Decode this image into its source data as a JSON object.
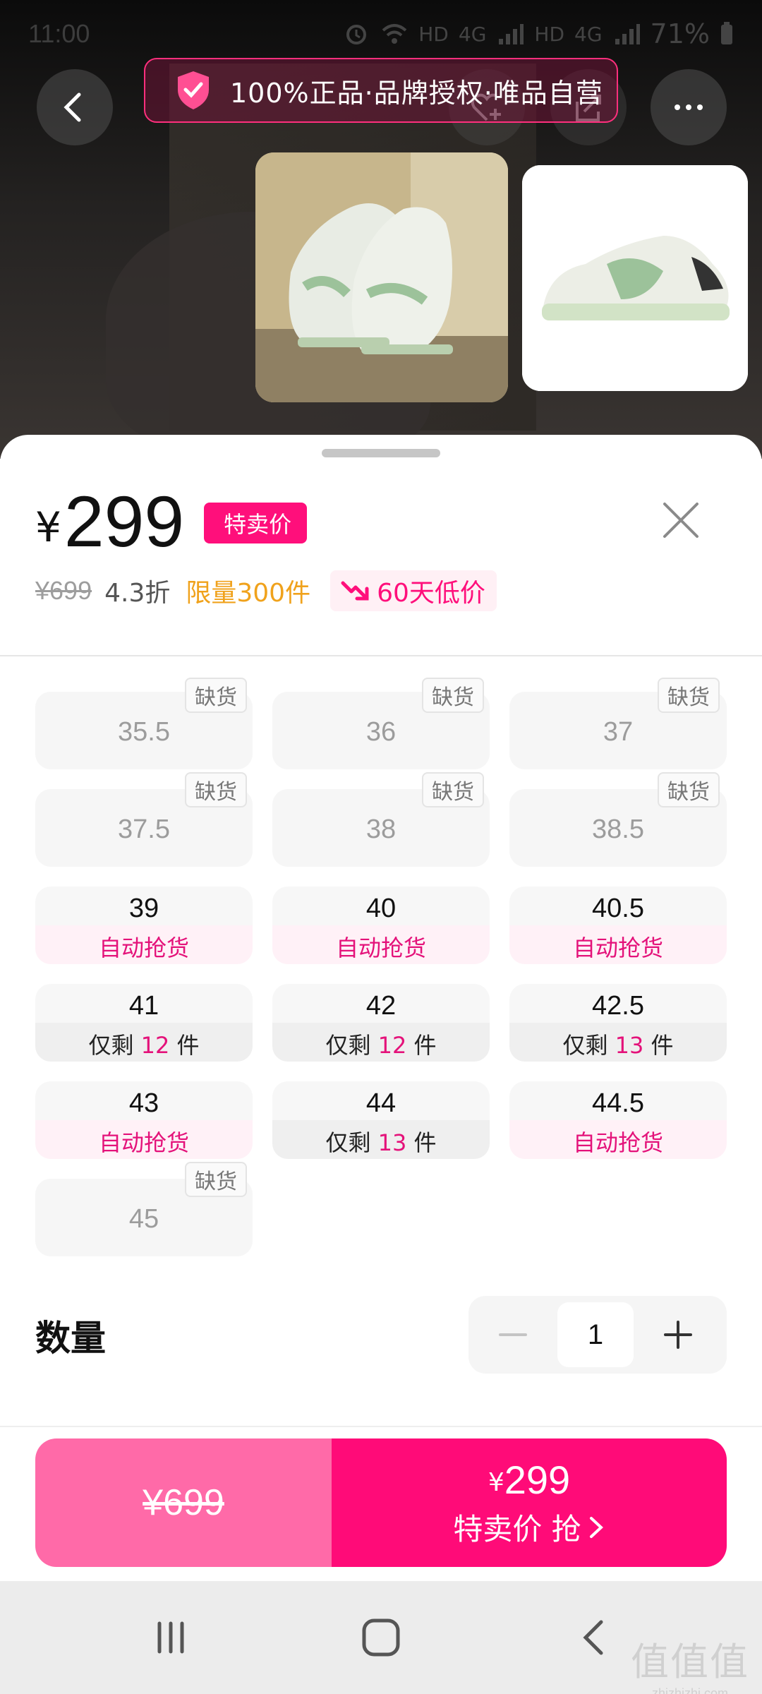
{
  "status_bar": {
    "time": "11:00",
    "network_1": "HD",
    "network_2": "4G",
    "network_3": "HD",
    "network_4": "4G",
    "battery": "71%"
  },
  "guarantee_banner": {
    "text": "100%正品·品牌授权·唯品自营"
  },
  "product": {
    "currency": "¥",
    "price": "299",
    "price_tag": "特卖价",
    "original_price": "¥699",
    "discount": "4.3折",
    "limit": "限量300件",
    "low_price_badge": "60天低价"
  },
  "sizes": [
    {
      "size": "35.5",
      "status": "oos",
      "badge": "缺货"
    },
    {
      "size": "36",
      "status": "oos",
      "badge": "缺货"
    },
    {
      "size": "37",
      "status": "oos",
      "badge": "缺货"
    },
    {
      "size": "37.5",
      "status": "oos",
      "badge": "缺货"
    },
    {
      "size": "38",
      "status": "oos",
      "badge": "缺货"
    },
    {
      "size": "38.5",
      "status": "oos",
      "badge": "缺货"
    },
    {
      "size": "39",
      "status": "auto",
      "sub": "自动抢货"
    },
    {
      "size": "40",
      "status": "auto",
      "sub": "自动抢货"
    },
    {
      "size": "40.5",
      "status": "auto",
      "sub": "自动抢货"
    },
    {
      "size": "41",
      "status": "left",
      "prefix": "仅剩 ",
      "count": "12",
      "suffix": " 件"
    },
    {
      "size": "42",
      "status": "left",
      "prefix": "仅剩 ",
      "count": "12",
      "suffix": " 件"
    },
    {
      "size": "42.5",
      "status": "left",
      "prefix": "仅剩 ",
      "count": "13",
      "suffix": " 件"
    },
    {
      "size": "43",
      "status": "auto",
      "sub": "自动抢货"
    },
    {
      "size": "44",
      "status": "left",
      "prefix": "仅剩 ",
      "count": "13",
      "suffix": " 件"
    },
    {
      "size": "44.5",
      "status": "auto",
      "sub": "自动抢货"
    },
    {
      "size": "45",
      "status": "oos",
      "badge": "缺货"
    }
  ],
  "quantity": {
    "label": "数量",
    "value": "1"
  },
  "buy_bar": {
    "left_price": "¥699",
    "right_currency": "¥",
    "right_price": "299",
    "right_cta": "特卖价 抢"
  },
  "watermark": {
    "line1": "值值值",
    "line2": "zhizhizhi.com"
  },
  "colors": {
    "accent": "#ff0b78",
    "accent_light": "#ff6aa8",
    "limit_orange": "#f0a21c"
  }
}
